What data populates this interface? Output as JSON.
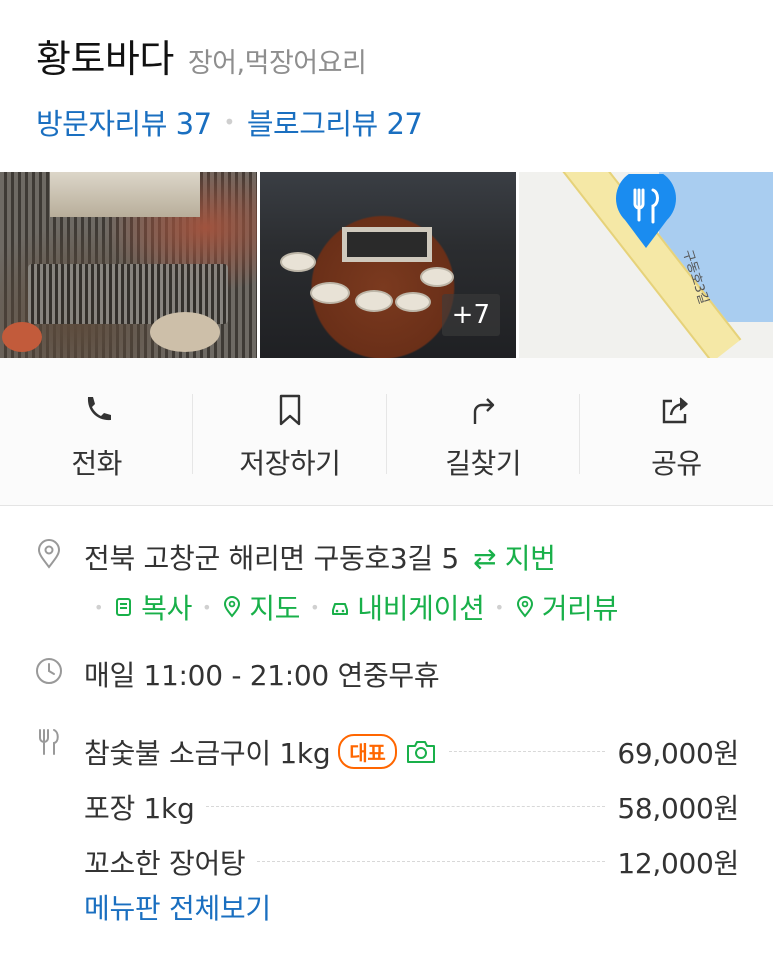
{
  "place": {
    "name": "황토바다",
    "category": "장어,먹장어요리"
  },
  "reviews": {
    "visitor": "방문자리뷰 37",
    "blog": "블로그리뷰 27"
  },
  "photos": {
    "more_count": "+7",
    "map_road_label": "구동호3길"
  },
  "actions": {
    "call": "전화",
    "save": "저장하기",
    "directions": "길찾기",
    "share": "공유"
  },
  "address": {
    "text": "전북 고창군 해리면 구동호3길 5",
    "jibun": "⇄ 지번",
    "copy": "복사",
    "map": "지도",
    "navigation": "내비게이션",
    "streetview": "거리뷰"
  },
  "hours": {
    "text": "매일 11:00 - 21:00 연중무휴"
  },
  "menu": {
    "items": [
      {
        "name": "참숯불 소금구이 1kg",
        "badge": "대표",
        "price": "69,000원"
      },
      {
        "name": "포장 1kg",
        "price": "58,000원"
      },
      {
        "name": "꼬소한 장어탕",
        "price": "12,000원"
      }
    ],
    "view_all": "메뉴판 전체보기"
  },
  "colors": {
    "link_blue": "#1a6fc0",
    "green": "#19b04a",
    "badge_orange": "#ff6600",
    "pin_blue": "#1a8cf0"
  }
}
